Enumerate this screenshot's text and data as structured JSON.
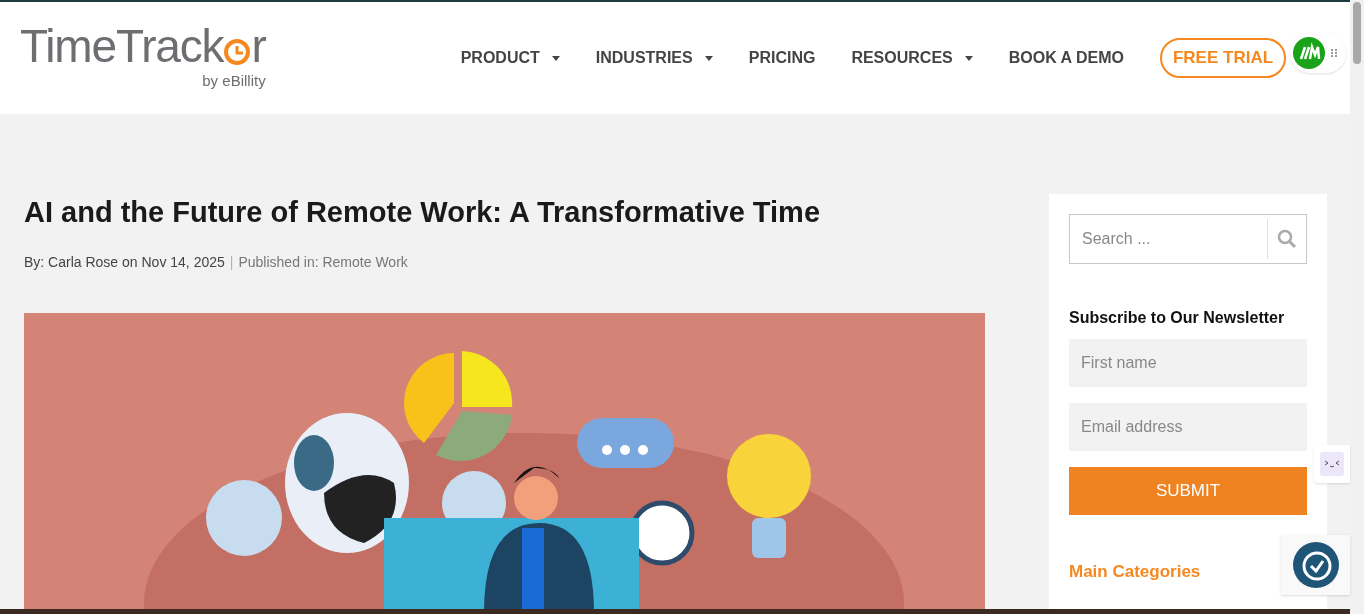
{
  "logo": {
    "name_start": "TimeTrack",
    "name_end": "r",
    "byline": "by eBillity"
  },
  "nav": [
    {
      "label": "PRODUCT",
      "dropdown": true
    },
    {
      "label": "INDUSTRIES",
      "dropdown": true
    },
    {
      "label": "PRICING",
      "dropdown": false
    },
    {
      "label": "RESOURCES",
      "dropdown": true
    },
    {
      "label": "BOOK A DEMO",
      "dropdown": false
    }
  ],
  "cta": "FREE TRIAL",
  "article": {
    "title": "AI and the Future of Remote Work: A Transformative Time",
    "byline": "By: Carla Rose on Nov 14, 2025",
    "separator": "|",
    "category_label": "Published in: Remote Work"
  },
  "sidebar": {
    "search": {
      "placeholder": "Search ..."
    },
    "newsletter": {
      "title": "Subscribe to Our Newsletter",
      "fields": [
        {
          "placeholder": "First name"
        },
        {
          "placeholder": "Email address"
        }
      ],
      "submit": "SUBMIT"
    },
    "categories_title": "Main Categories"
  }
}
